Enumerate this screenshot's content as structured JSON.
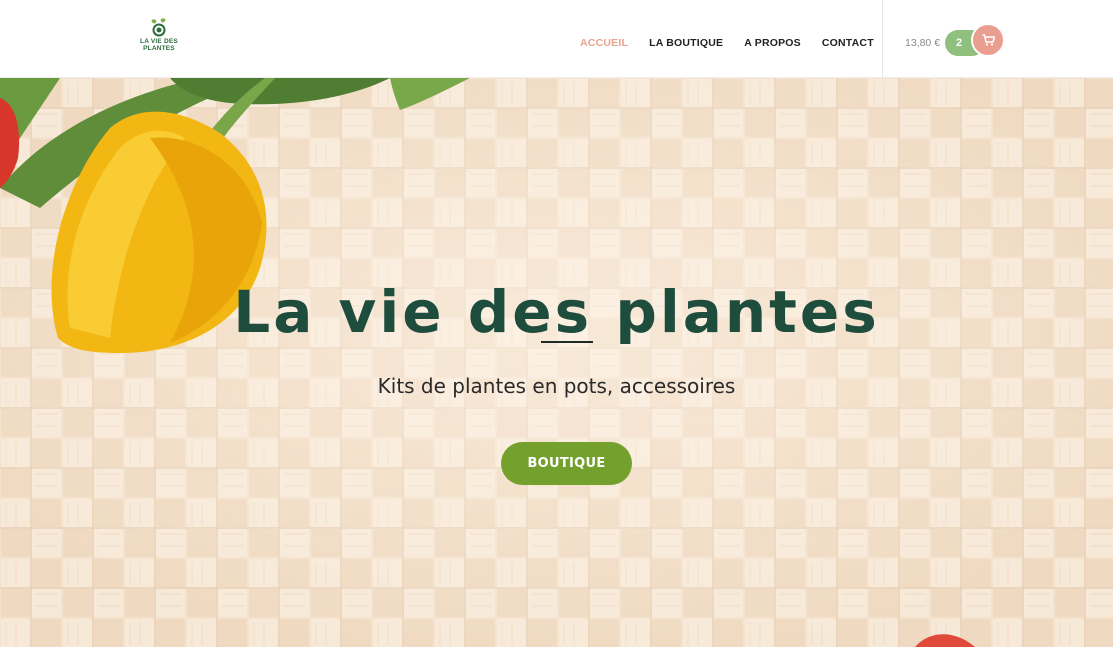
{
  "brand": {
    "logo_text_line1": "LA VIE DES",
    "logo_text_line2": "PLANTES",
    "color_primary": "#1f4d3d",
    "color_accent": "#e9a28f",
    "color_button": "#74a12e"
  },
  "nav": {
    "items": [
      {
        "label": "ACCUEIL",
        "active": true
      },
      {
        "label": "LA BOUTIQUE",
        "active": false
      },
      {
        "label": "A PROPOS",
        "active": false
      },
      {
        "label": "CONTACT",
        "active": false
      }
    ]
  },
  "cart": {
    "total": "13,80 €",
    "count": "2",
    "icon": "cart-icon"
  },
  "hero": {
    "title": "La vie des plantes",
    "subtitle": "Kits de plantes en pots, accessoires",
    "button_label": "BOUTIQUE"
  }
}
